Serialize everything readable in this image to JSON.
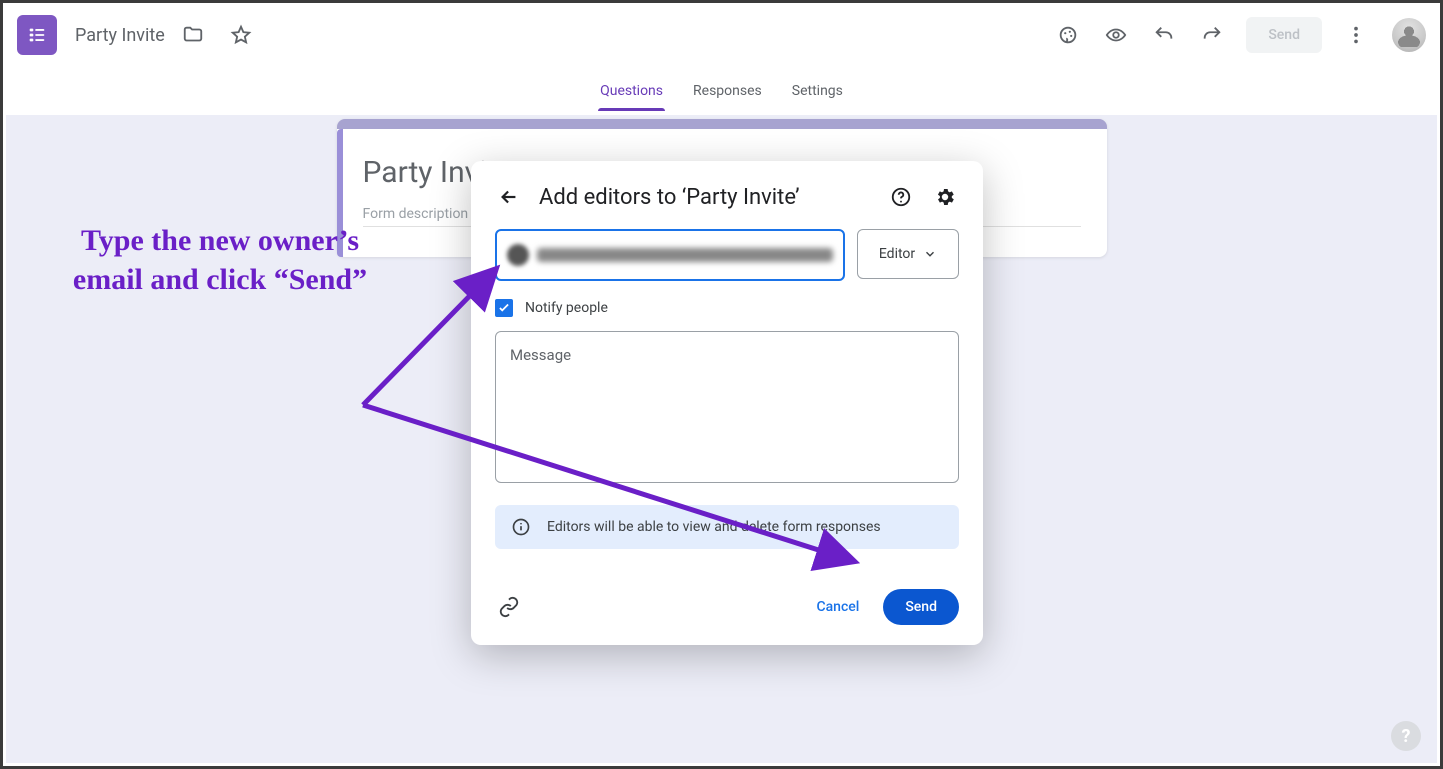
{
  "header": {
    "doc_title": "Party Invite",
    "send_label": "Send"
  },
  "tabs": {
    "questions": "Questions",
    "responses": "Responses",
    "settings": "Settings"
  },
  "form": {
    "title": "Party Invite",
    "description_placeholder": "Form description"
  },
  "dialog": {
    "title": "Add editors to ‘Party Invite’",
    "role_label": "Editor",
    "notify_label": "Notify people",
    "message_placeholder": "Message",
    "info_text": "Editors will be able to view and delete form responses",
    "cancel_label": "Cancel",
    "send_label": "Send"
  },
  "annotation": {
    "text": "Type the new owner’s email and click “Send”"
  },
  "help_fab": "?"
}
